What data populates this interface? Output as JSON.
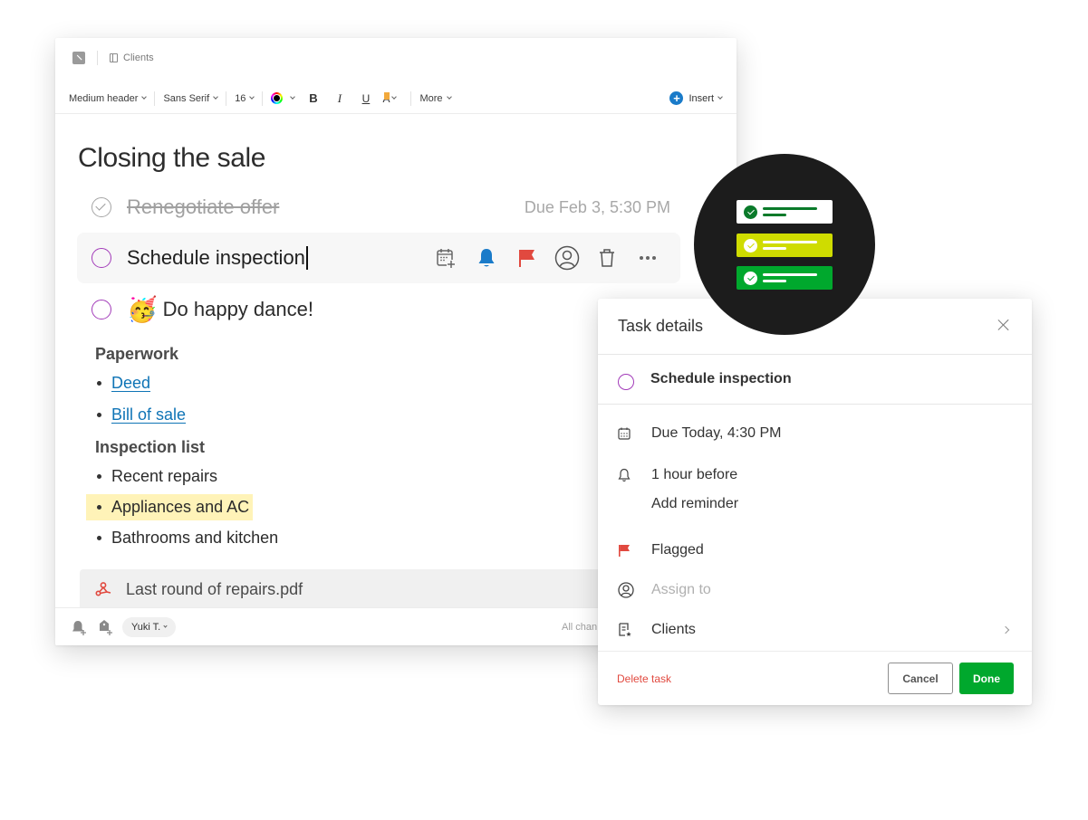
{
  "editor": {
    "notebook": "Clients",
    "toolbar": {
      "style": "Medium header",
      "font": "Sans Serif",
      "size": "16",
      "bold": "B",
      "italic": "I",
      "underline": "U",
      "highlight": "A",
      "more": "More",
      "insert": "Insert",
      "insert_icon": "+"
    },
    "title": "Closing the sale",
    "tasks": [
      {
        "text": "Renegotiate offer",
        "completed": true,
        "due": "Due Feb 3, 5:30 PM"
      },
      {
        "text": "Schedule inspection",
        "completed": false,
        "active": true
      },
      {
        "emoji": "🥳",
        "text": "Do happy dance!",
        "completed": false
      }
    ],
    "sections": [
      {
        "heading": "Paperwork",
        "items": [
          {
            "text": "Deed",
            "link": true
          },
          {
            "text": "Bill of sale",
            "link": true
          }
        ]
      },
      {
        "heading": "Inspection list",
        "items": [
          {
            "text": "Recent repairs"
          },
          {
            "text": "Appliances and AC",
            "highlighted": true
          },
          {
            "text": "Bathrooms and kitchen"
          }
        ]
      }
    ],
    "attachment": "Last round of repairs.pdf",
    "footer": {
      "user": "Yuki T.",
      "status": "All chan"
    }
  },
  "panel": {
    "title": "Task details",
    "task_name": "Schedule inspection",
    "due": "Due Today, 4:30 PM",
    "reminder": "1 hour before",
    "add_reminder": "Add reminder",
    "flag": "Flagged",
    "assign_placeholder": "Assign to",
    "note": "Clients",
    "delete": "Delete task",
    "cancel": "Cancel",
    "done": "Done"
  },
  "colors": {
    "accent_green": "#00a82d",
    "task_purple": "#a23bb9",
    "link_blue": "#0f74b6",
    "flag_red": "#e1493f",
    "bell_blue": "#1a7bc9",
    "highlight_yellow": "#fff3b8",
    "badge_lime": "#cfdc00"
  }
}
